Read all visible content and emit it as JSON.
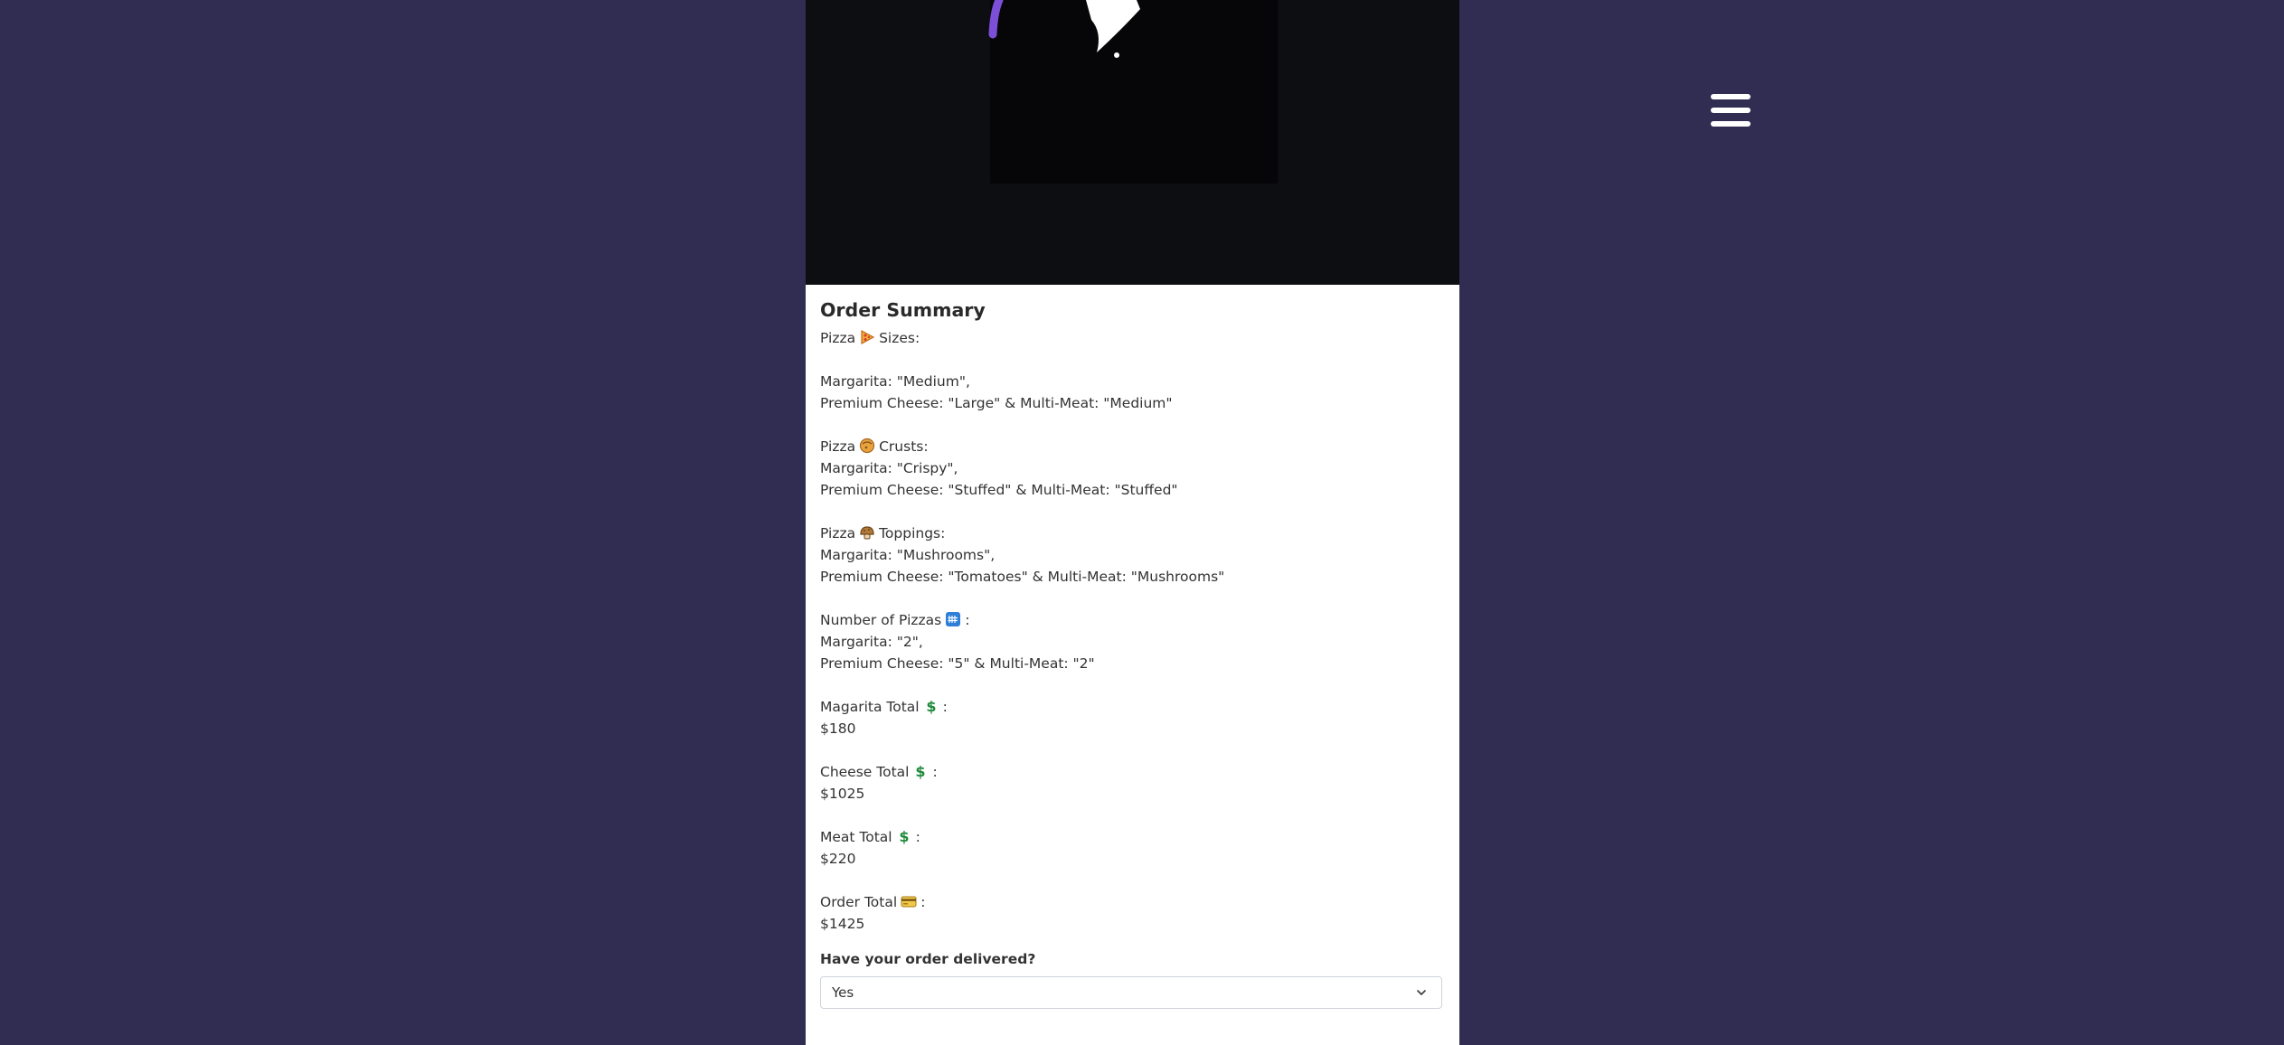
{
  "header": {
    "menu_icon": "hamburger-menu-icon"
  },
  "hero": {
    "image_icon": "logo-image"
  },
  "summary": {
    "title": "Order Summary",
    "sizes": {
      "heading_pre": "Pizza",
      "heading_post": "Sizes:",
      "icon": "pizza-slice-icon",
      "line1": "Margarita: \"Medium\",",
      "line2": "Premium Cheese: \"Large\" & Multi-Meat: \"Medium\""
    },
    "crusts": {
      "heading_pre": "Pizza",
      "heading_post": "Crusts:",
      "icon": "crust-icon",
      "line1": "Margarita: \"Crispy\",",
      "line2": "Premium Cheese: \"Stuffed\" & Multi-Meat: \"Stuffed\""
    },
    "toppings": {
      "heading_pre": "Pizza",
      "heading_post": "Toppings:",
      "icon": "mushroom-topping-icon",
      "line1": "Margarita: \"Mushrooms\",",
      "line2": "Premium Cheese: \"Tomatoes\" & Multi-Meat: \"Mushrooms\""
    },
    "count": {
      "heading": "Number of Pizzas",
      "suffix": ":",
      "icon": "numbers-icon",
      "line1": "Margarita: \"2\",",
      "line2": "Premium Cheese: \"5\" & Multi-Meat: \"2\""
    },
    "margarita_total": {
      "label": "Magarita Total",
      "suffix": ":",
      "icon": "dollar-icon",
      "value": "$180"
    },
    "cheese_total": {
      "label": "Cheese Total",
      "suffix": ":",
      "icon": "dollar-icon",
      "value": "$1025"
    },
    "meat_total": {
      "label": "Meat Total",
      "suffix": ":",
      "icon": "dollar-icon",
      "value": "$220"
    },
    "order_total": {
      "label": "Order Total",
      "suffix": ":",
      "icon": "credit-card-icon",
      "value": "$1425"
    }
  },
  "delivery": {
    "label": "Have your order delivered?",
    "selected": "Yes"
  },
  "colors": {
    "background": "#312c51",
    "panel": "#ffffff",
    "hero": "#0d0e11",
    "accent": "#7b4fd8"
  }
}
